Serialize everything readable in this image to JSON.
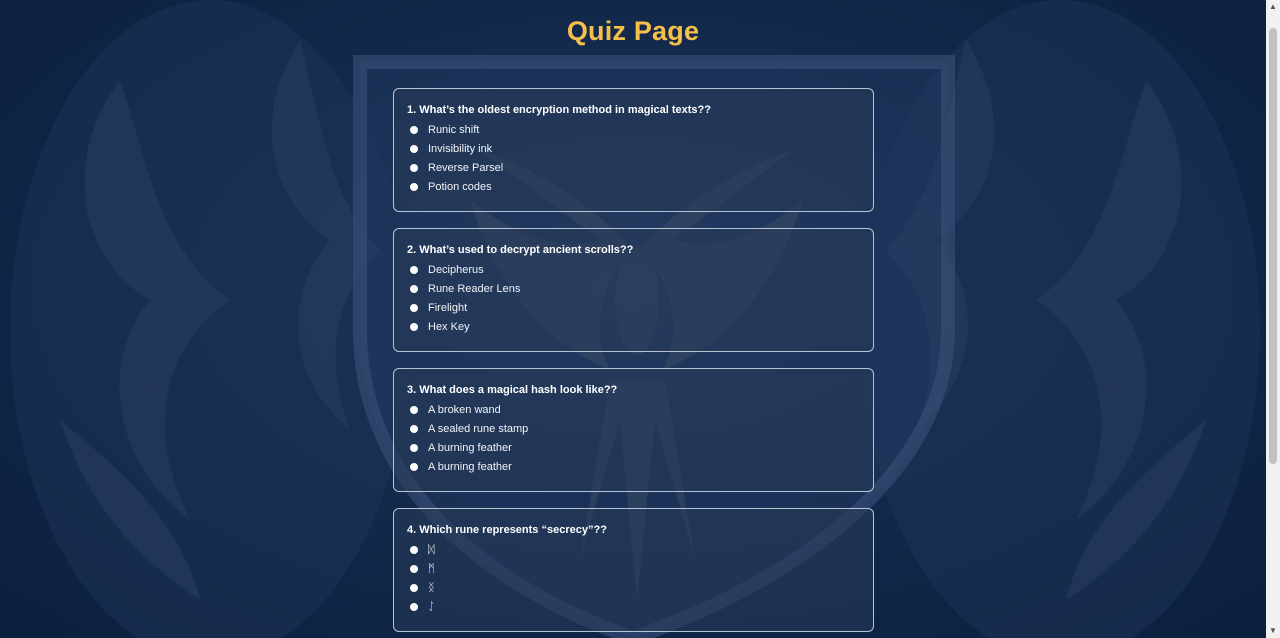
{
  "page": {
    "title": "Quiz Page"
  },
  "colors": {
    "title": "#f5c04a",
    "background": "#0f2444",
    "card_border": "#b9c3d3"
  },
  "questions": [
    {
      "text": "1. What’s the oldest encryption method in magical texts??",
      "options": [
        "Runic shift",
        "Invisibility ink",
        "Reverse Parsel",
        "Potion codes"
      ]
    },
    {
      "text": "2. What’s used to decrypt ancient scrolls??",
      "options": [
        "Decipherus",
        "Rune Reader Lens",
        "Firelight",
        "Hex Key"
      ]
    },
    {
      "text": "3. What does a magical hash look like??",
      "options": [
        "A broken wand",
        "A sealed rune stamp",
        "A burning feather",
        "A burning feather"
      ]
    },
    {
      "text": "4. Which rune represents “secrecy”??",
      "options": [
        "ᛞ",
        "ᛗ",
        "ᛝ",
        "ᛇ"
      ]
    }
  ],
  "scrollbar": {
    "up_icon": "scroll-up-arrow-icon",
    "down_icon": "scroll-down-arrow-icon"
  }
}
